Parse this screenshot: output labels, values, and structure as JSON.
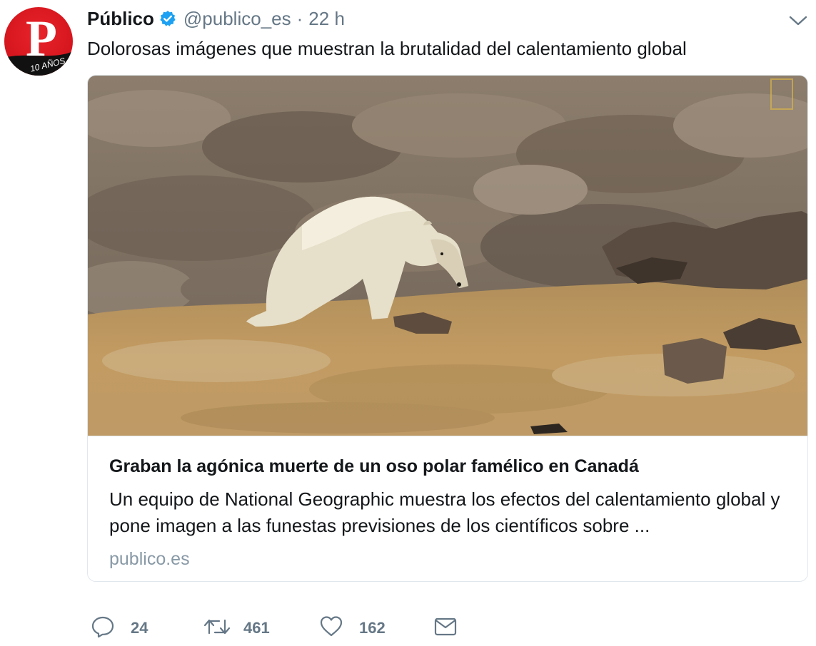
{
  "tweet": {
    "author_name": "Público",
    "handle": "@publico_es",
    "separator": "·",
    "time": "22 h",
    "text": "Dolorosas imágenes que muestran la brutalidad del calentamiento global"
  },
  "avatar": {
    "logo_letter": "P",
    "anniversary_text": "10 AÑOS"
  },
  "card": {
    "image_alt": "polar bear photo",
    "title": "Graban la agónica muerte de un oso polar famélico en Canadá",
    "description": "Un equipo de National Geographic muestra los efectos del calentamiento global y pone imagen a las funestas previsiones de los científicos sobre ...",
    "domain": "publico.es"
  },
  "actions": {
    "replies": "24",
    "retweets": "461",
    "likes": "162"
  },
  "icons": {
    "verified": "verified-badge-icon",
    "caret": "chevron-down-icon",
    "reply": "reply-icon",
    "retweet": "retweet-icon",
    "like": "heart-icon",
    "message": "envelope-icon"
  },
  "colors": {
    "verified_blue": "#1da1f2",
    "secondary_text": "#657786",
    "brand_red": "#d4151d"
  }
}
